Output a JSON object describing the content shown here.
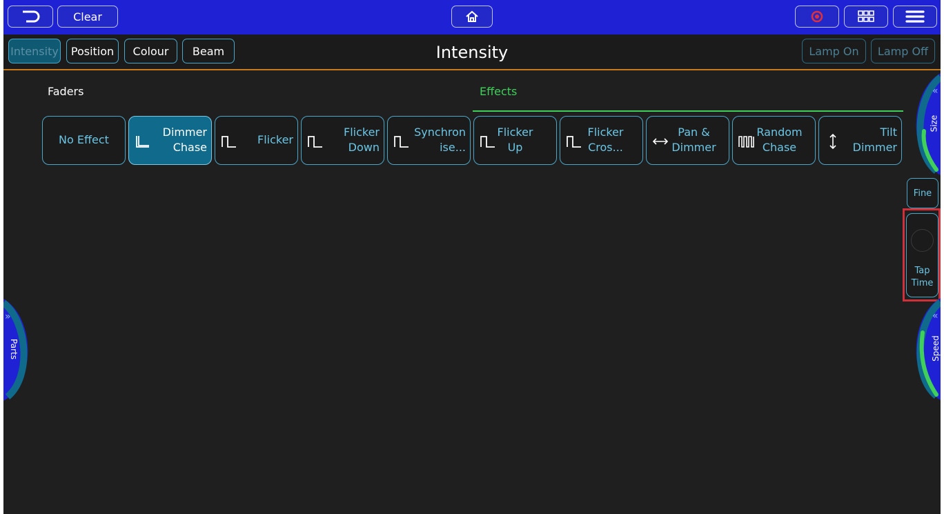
{
  "topbar": {
    "clear_label": "Clear"
  },
  "subbar": {
    "tabs": [
      {
        "label": "Intensity"
      },
      {
        "label": "Position"
      },
      {
        "label": "Colour"
      },
      {
        "label": "Beam"
      }
    ],
    "title": "Intensity",
    "lamp_on": "Lamp On",
    "lamp_off": "Lamp Off"
  },
  "sections": {
    "faders": "Faders",
    "effects": "Effects"
  },
  "effects": [
    {
      "label": "No Effect",
      "icon": "none",
      "selected": false
    },
    {
      "label": "Dimmer Chase",
      "icon": "step-icon",
      "selected": true
    },
    {
      "label": "Flicker",
      "icon": "pulse-icon",
      "selected": false
    },
    {
      "label": "Flicker Down",
      "icon": "pulse-icon",
      "selected": false
    },
    {
      "label": "Synchron ise...",
      "icon": "pulse-icon",
      "selected": false
    },
    {
      "label": "Flicker Up",
      "icon": "pulse-icon",
      "selected": false
    },
    {
      "label": "Flicker Cros...",
      "icon": "pulse-icon",
      "selected": false
    },
    {
      "label": "Pan & Dimmer",
      "icon": "horizontal-arrows-icon",
      "selected": false
    },
    {
      "label": "Random Chase",
      "icon": "square-wave-icon",
      "selected": false
    },
    {
      "label": "Tilt Dimmer",
      "icon": "vertical-arrows-icon",
      "selected": false
    }
  ],
  "right_controls": {
    "size_label": "Size",
    "fine_label": "Fine",
    "tap_time_label": "Tap Time",
    "speed_label": "Speed"
  },
  "left_controls": {
    "parts_label": "Parts"
  },
  "colors": {
    "topbar": "#1f22d4",
    "accent_cyan": "#4ba7c9",
    "effects_green": "#3fcf5a",
    "record_red": "#e0303a",
    "highlight_red": "#d0303a"
  }
}
